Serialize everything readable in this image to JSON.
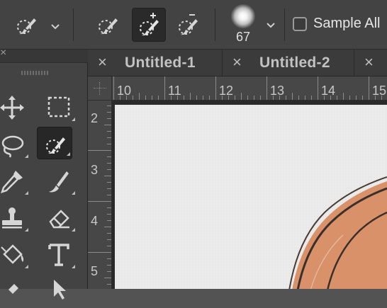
{
  "options_bar": {
    "tool_presets": {
      "icon": "quick-selection-brush-icon"
    },
    "modes": [
      {
        "icon": "new-selection-brush-icon"
      },
      {
        "icon": "add-to-selection-brush-icon",
        "active": true
      },
      {
        "icon": "subtract-from-selection-brush-icon"
      }
    ],
    "brush_size": "67",
    "sample_all_layers": {
      "label": "Sample All",
      "checked": false
    }
  },
  "tabs": [
    {
      "title": "Untitled-1"
    },
    {
      "title": "Untitled-2"
    }
  ],
  "ruler": {
    "horizontal_labels": [
      "10",
      "11",
      "12",
      "13",
      "14",
      "15"
    ],
    "vertical_labels": [
      "2",
      "3",
      "4",
      "5"
    ]
  },
  "tools": [
    {
      "name": "move-tool",
      "icon": "move-icon"
    },
    {
      "name": "rectangular-marquee-tool",
      "icon": "marquee-icon"
    },
    {
      "name": "lasso-tool",
      "icon": "lasso-icon"
    },
    {
      "name": "quick-selection-tool",
      "icon": "quick-selection-icon",
      "active": true
    },
    {
      "name": "eyedropper-tool",
      "icon": "eyedropper-icon"
    },
    {
      "name": "brush-tool",
      "icon": "brush-icon"
    },
    {
      "name": "clone-stamp-tool",
      "icon": "stamp-icon"
    },
    {
      "name": "eraser-tool",
      "icon": "eraser-icon"
    },
    {
      "name": "paint-bucket-tool",
      "icon": "paint-bucket-icon"
    },
    {
      "name": "type-tool",
      "icon": "type-icon"
    }
  ],
  "colors": {
    "accent_dark": "#2a2a2a",
    "canvas": "#ebebeb",
    "artwork": "#d9916a"
  }
}
